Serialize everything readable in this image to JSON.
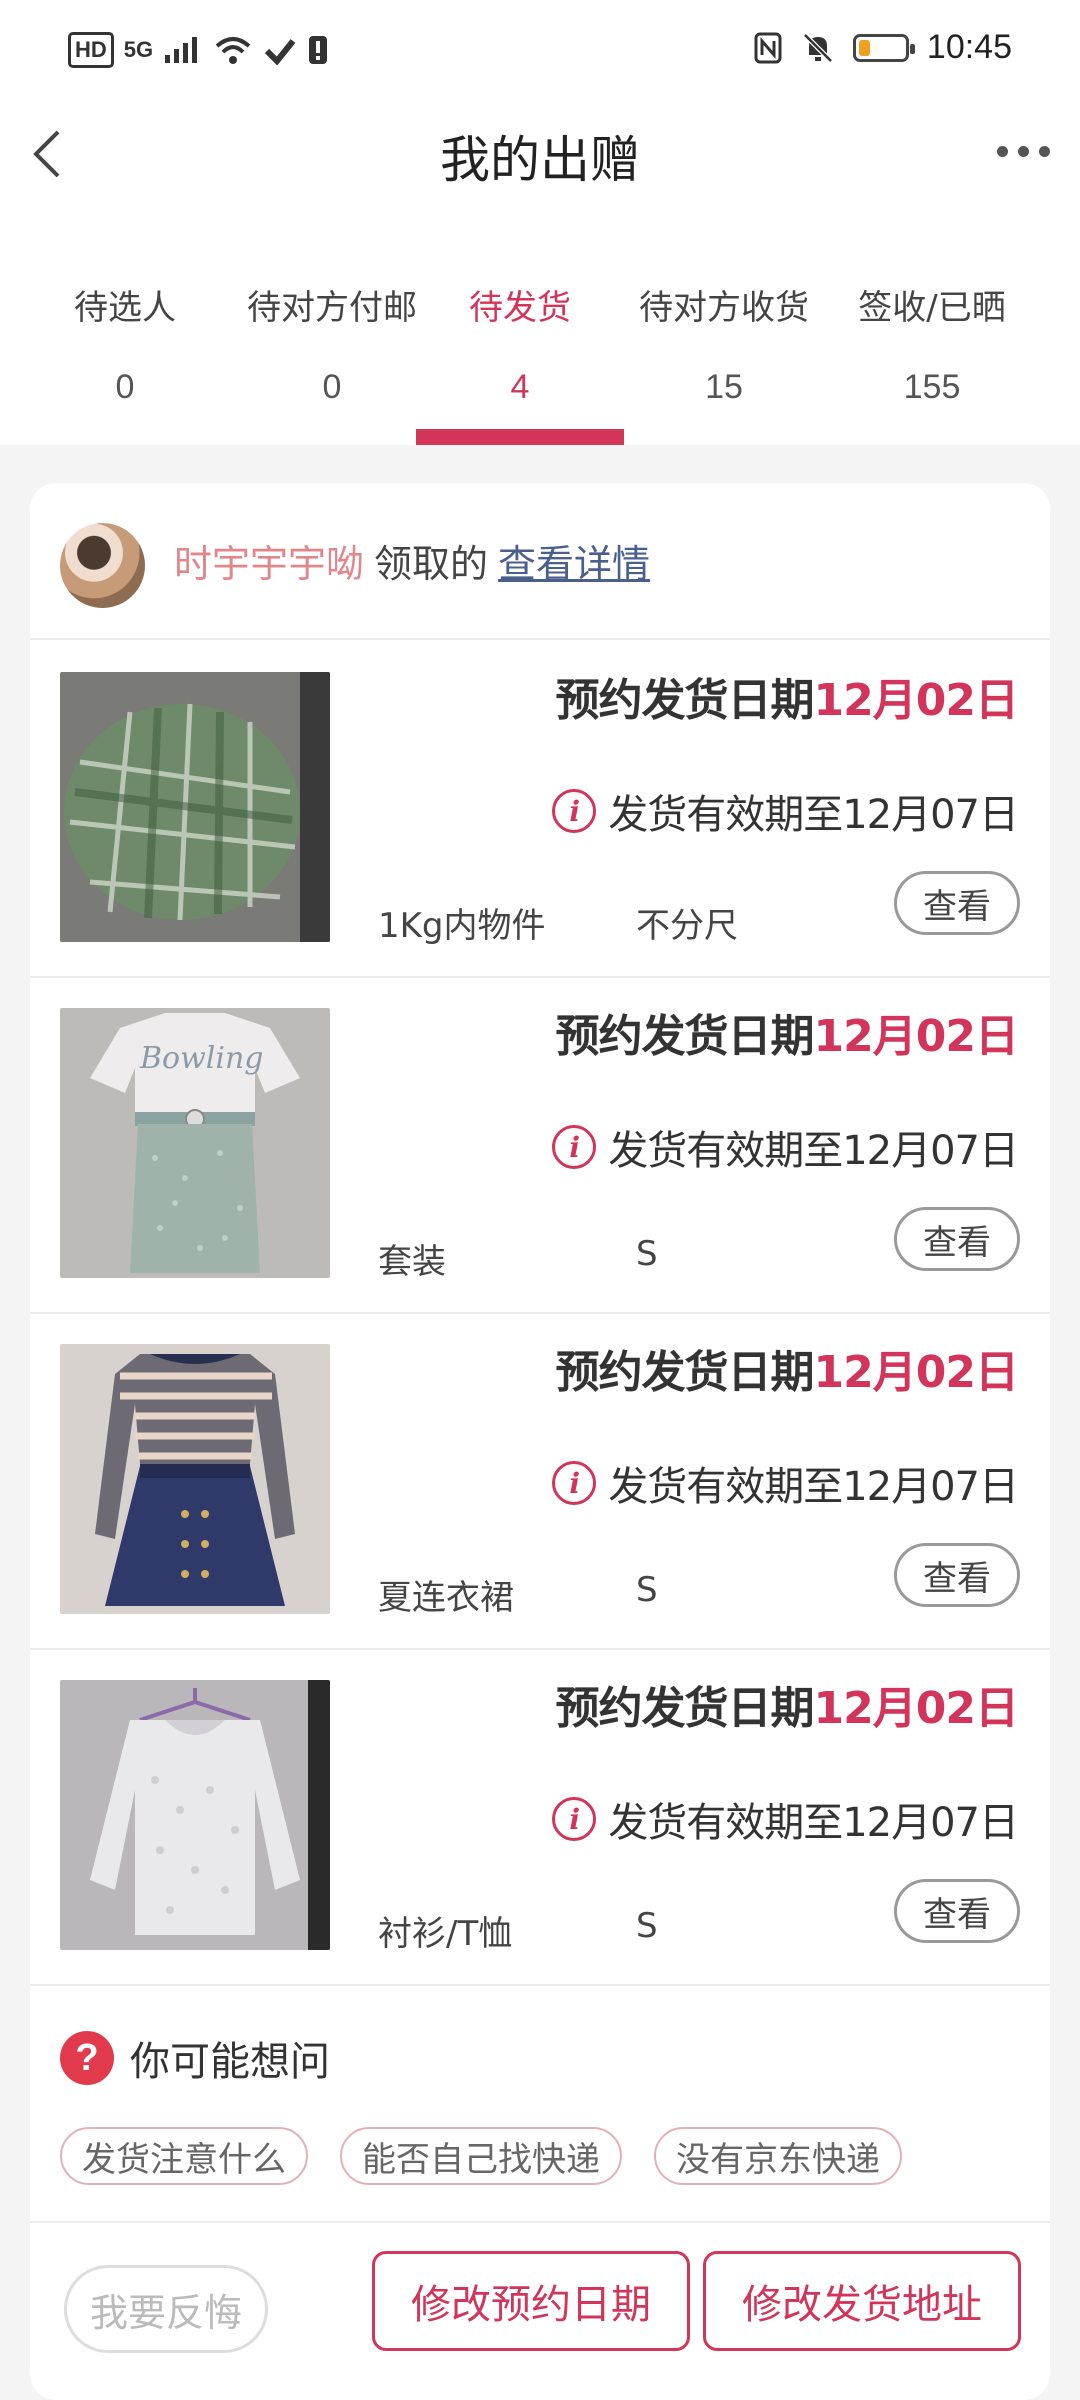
{
  "status_bar": {
    "left": {
      "hd": "HD",
      "network": "5G"
    },
    "time": "10:45",
    "battery_level": 0.25,
    "icons": [
      "hd-icon",
      "signal-icon",
      "wifi-icon",
      "nfc-icon",
      "mute-icon",
      "battery-icon"
    ]
  },
  "header": {
    "title": "我的出赠"
  },
  "tabs": [
    {
      "label": "待选人",
      "count": "0"
    },
    {
      "label": "待对方付邮",
      "count": "0"
    },
    {
      "label": "待发货",
      "count": "4",
      "active": true
    },
    {
      "label": "待对方收货",
      "count": "15"
    },
    {
      "label": "签收/已晒",
      "count": "155"
    }
  ],
  "donor": {
    "name": "时宇宇宇呦",
    "action_text": "领取的",
    "detail_link": "查看详情"
  },
  "items": [
    {
      "schedule_label": "预约发货日期",
      "schedule_date": "12月02日",
      "valid_text": "发货有效期至12月07日",
      "category": "1Kg内物件",
      "size": "不分尺",
      "view_label": "查看"
    },
    {
      "schedule_label": "预约发货日期",
      "schedule_date": "12月02日",
      "valid_text": "发货有效期至12月07日",
      "category": "套装",
      "size": "S",
      "view_label": "查看"
    },
    {
      "schedule_label": "预约发货日期",
      "schedule_date": "12月02日",
      "valid_text": "发货有效期至12月07日",
      "category": "夏连衣裙",
      "size": "S",
      "view_label": "查看"
    },
    {
      "schedule_label": "预约发货日期",
      "schedule_date": "12月02日",
      "valid_text": "发货有效期至12月07日",
      "category": "衬衫/T恤",
      "size": "S",
      "view_label": "查看"
    }
  ],
  "faq": {
    "title": "你可能想问",
    "chips": [
      "发货注意什么",
      "能否自己找快递",
      "没有京东快递"
    ]
  },
  "actions": {
    "regret": "我要反悔",
    "change_date": "修改预约日期",
    "change_address": "修改发货地址"
  },
  "colors": {
    "accent": "#d2345a",
    "donor_name": "#e3868c",
    "link": "#4a5f8c"
  }
}
